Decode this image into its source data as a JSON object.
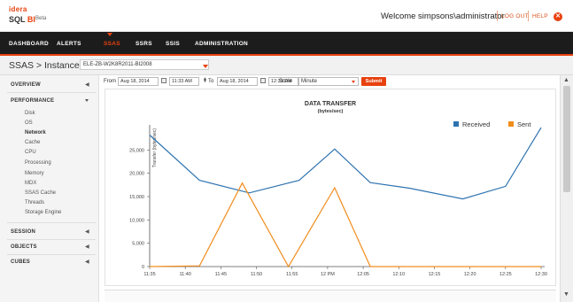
{
  "header": {
    "brand": "idera",
    "product_prefix": "SQL ",
    "product_bi": "BI",
    "beta": "Beta",
    "welcome": "Welcome simpsons\\administrator",
    "logout": "LOG OUT",
    "help": "HELP"
  },
  "nav": {
    "items": [
      {
        "label": "DASHBOARD"
      },
      {
        "label": "ALERTS"
      },
      {
        "label": "SSAS"
      },
      {
        "label": "SSRS"
      },
      {
        "label": "SSIS"
      },
      {
        "label": "ADMINISTRATION"
      }
    ],
    "active": "SSAS"
  },
  "breadcrumb": {
    "text": "SSAS > Instance -",
    "instance": "ELE-ZB-W2K8R2011-BI2008"
  },
  "sidebar": {
    "sections": [
      {
        "label": "OVERVIEW"
      },
      {
        "label": "PERFORMANCE"
      },
      {
        "label": "SESSION"
      },
      {
        "label": "OBJECTS"
      },
      {
        "label": "CUBES"
      }
    ],
    "performance_items": [
      {
        "label": "Disk"
      },
      {
        "label": "OS"
      },
      {
        "label": "Network"
      },
      {
        "label": "Cache"
      },
      {
        "label": "CPU"
      },
      {
        "label": "Processing"
      },
      {
        "label": "Memory"
      },
      {
        "label": "MDX"
      },
      {
        "label": "SSAS Cache"
      },
      {
        "label": "Threads"
      },
      {
        "label": "Storage Engine"
      }
    ],
    "active_item": "Network"
  },
  "filter": {
    "from_label": "From",
    "from_date": "Aug 18, 2014",
    "from_time": "11:33 AM",
    "to_label": "To",
    "to_date": "Aug 18, 2014",
    "to_time": "12:33 PM",
    "scale_label": "Scale",
    "scale_value": "Minute",
    "submit": "Submit"
  },
  "colors": {
    "accent": "#e8410f",
    "received": "#2e73b0",
    "sent": "#f28c1c"
  },
  "chart_data": {
    "type": "line",
    "title": "DATA TRANSFER",
    "subtitle": "(bytes/sec)",
    "ylabel": "Transfer (bytes/sec)",
    "xlabel": "",
    "categories": [
      "11:35",
      "11:40",
      "11:45",
      "11:50",
      "11:55",
      "12 PM",
      "12:05",
      "12:10",
      "12:15",
      "12:20",
      "12:25",
      "12:30"
    ],
    "x": [
      "11:35",
      "11:40",
      "11:45",
      "11:50",
      "11:55",
      "12 PM",
      "12:05",
      "12:10",
      "12:15",
      "12:20",
      "12:25",
      "12:30"
    ],
    "ylim": [
      0,
      30000
    ],
    "yticks": [
      0,
      5000,
      10000,
      15000,
      20000,
      25000
    ],
    "ytick_labels": [
      "0",
      "5,000",
      "10,000",
      "15,000",
      "20,000",
      "25,000"
    ],
    "legend_position": "top-right",
    "grid": false,
    "received_points": [
      [
        0,
        28200
      ],
      [
        1.4,
        18500
      ],
      [
        2.8,
        15800
      ],
      [
        4.2,
        18500
      ],
      [
        5.2,
        25200
      ],
      [
        6.2,
        18000
      ],
      [
        7.3,
        16800
      ],
      [
        8.8,
        14500
      ],
      [
        10.0,
        17200
      ],
      [
        11.0,
        29800
      ]
    ],
    "sent_points": [
      [
        0,
        0
      ],
      [
        1.4,
        150
      ],
      [
        2.6,
        17900
      ],
      [
        3.9,
        0
      ],
      [
        5.2,
        16900
      ],
      [
        6.2,
        0
      ],
      [
        11.0,
        0
      ]
    ],
    "series": [
      {
        "name": "Received",
        "values": [
          28200,
          18500,
          15800,
          18500,
          25200,
          18000,
          16800,
          14500,
          17200,
          29800
        ]
      },
      {
        "name": "Sent",
        "values": [
          0,
          150,
          17900,
          0,
          16900,
          0,
          0
        ]
      }
    ]
  }
}
